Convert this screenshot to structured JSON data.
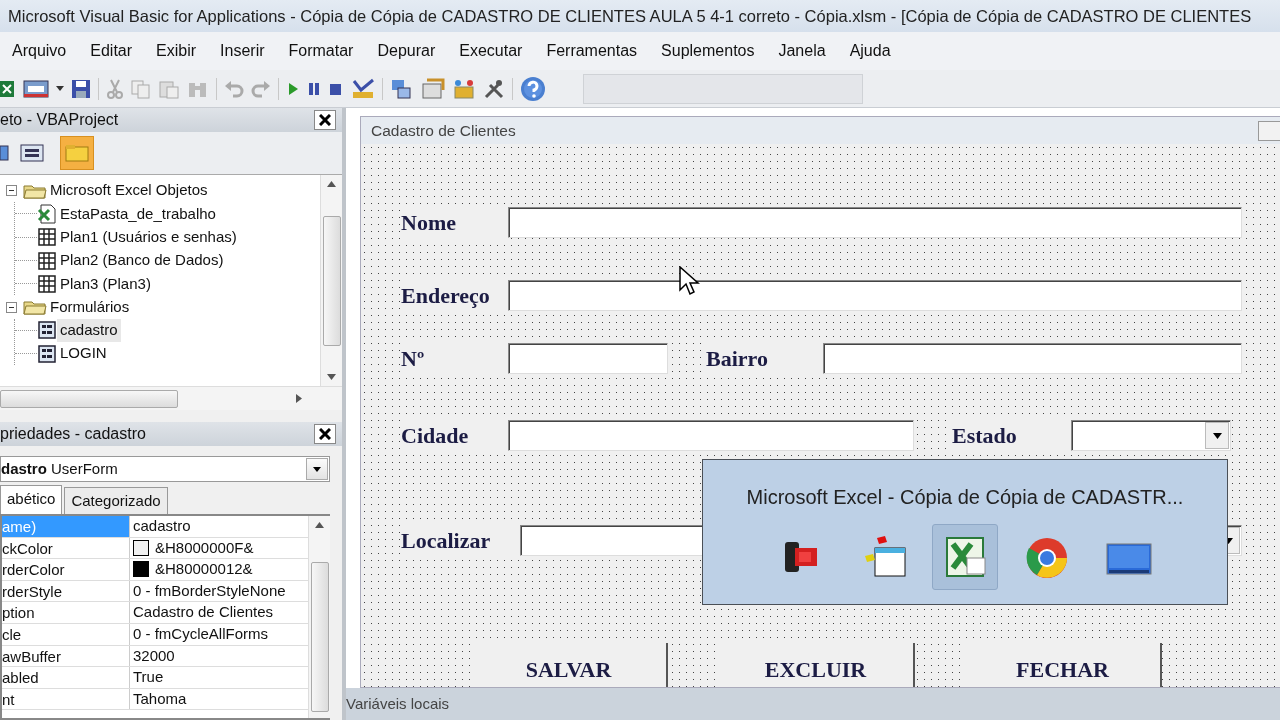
{
  "window": {
    "title": "Microsoft Visual Basic for Applications - Cópia de Cópia de CADASTRO DE CLIENTES AULA 5 4-1 correto - Cópia.xlsm - [Cópia de Cópia de CADASTRO DE CLIENTES"
  },
  "menu": [
    "Arquivo",
    "Editar",
    "Exibir",
    "Inserir",
    "Formatar",
    "Depurar",
    "Executar",
    "Ferramentas",
    "Suplementos",
    "Janela",
    "Ajuda"
  ],
  "project": {
    "title": "eto - VBAProject",
    "tree": [
      {
        "label": "Microsoft Excel Objetos",
        "kind": "folder",
        "expanded": true,
        "selected": false,
        "children": [
          {
            "label": "EstaPasta_de_trabalho",
            "kind": "workbook",
            "selected": false
          },
          {
            "label": "Plan1 (Usuários e senhas)",
            "kind": "sheet",
            "selected": false
          },
          {
            "label": "Plan2 (Banco de Dados)",
            "kind": "sheet",
            "selected": false
          },
          {
            "label": "Plan3 (Plan3)",
            "kind": "sheet",
            "selected": false
          }
        ]
      },
      {
        "label": "Formulários",
        "kind": "folder",
        "expanded": true,
        "selected": false,
        "children": [
          {
            "label": "cadastro",
            "kind": "form",
            "selected": true
          },
          {
            "label": "LOGIN",
            "kind": "form",
            "selected": false
          }
        ]
      }
    ]
  },
  "properties": {
    "title": "priedades - cadastro",
    "object_name": "dastro",
    "object_type": "UserForm",
    "tabs": [
      {
        "label": "abético",
        "selected": true
      },
      {
        "label": "Categorizado",
        "selected": false
      }
    ],
    "rows": [
      {
        "name": "ame)",
        "value": "cadastro",
        "selected": true
      },
      {
        "name": "ckColor",
        "value": "&H8000000F&",
        "color": "#f0f0f0",
        "selected": false
      },
      {
        "name": "rderColor",
        "value": "&H80000012&",
        "color": "#000000",
        "selected": false
      },
      {
        "name": "rderStyle",
        "value": "0 - fmBorderStyleNone",
        "selected": false
      },
      {
        "name": "ption",
        "value": "Cadastro de Clientes",
        "selected": false
      },
      {
        "name": "cle",
        "value": "0 - fmCycleAllForms",
        "selected": false
      },
      {
        "name": "awBuffer",
        "value": "32000",
        "selected": false
      },
      {
        "name": "abled",
        "value": "True",
        "selected": false
      },
      {
        "name": "nt",
        "value": "Tahoma",
        "selected": false
      }
    ]
  },
  "form": {
    "title": "Cadastro de Clientes",
    "rows": [
      [
        {
          "label": "Nome",
          "kind": "text"
        }
      ],
      [
        {
          "label": "Endereço",
          "kind": "text"
        }
      ],
      [
        {
          "label": "Nº",
          "kind": "text"
        },
        {
          "label": "Bairro",
          "kind": "text"
        }
      ],
      [
        {
          "label": "Cidade",
          "kind": "text"
        },
        {
          "label": "Estado",
          "kind": "combo"
        }
      ],
      [
        {
          "label": "Localizar",
          "kind": "combo"
        }
      ]
    ],
    "buttons": [
      "SALVAR",
      "EXCLUIR",
      "FECHAR"
    ]
  },
  "preview": {
    "title": "Microsoft Excel - Cópia de Cópia de CADASTR...",
    "thumbnails": [
      {
        "selected": false
      },
      {
        "selected": false
      },
      {
        "selected": true
      },
      {
        "selected": false
      },
      {
        "selected": false
      }
    ]
  },
  "status_bar": {
    "label": "Variáveis locais"
  }
}
